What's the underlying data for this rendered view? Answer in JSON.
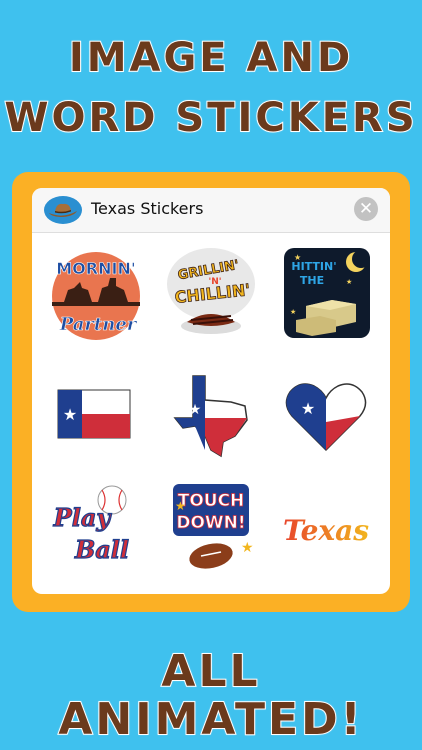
{
  "headline": {
    "line1": "IMAGE AND",
    "line2": "WORD STICKERS",
    "line3": "ALL ANIMATED!"
  },
  "panel": {
    "title": "Texas Stickers",
    "close_symbol": "✕"
  },
  "stickers": [
    {
      "name": "mornin-partner",
      "lines": [
        "MORNIN'",
        "Partner"
      ]
    },
    {
      "name": "grillin-n-chillin",
      "lines": [
        "GRILLIN'",
        "'N'",
        "CHILLIN'"
      ]
    },
    {
      "name": "hittin-the-hay",
      "lines": [
        "HITTIN'",
        "THE"
      ]
    },
    {
      "name": "texas-flag",
      "lines": []
    },
    {
      "name": "texas-map-flag",
      "lines": []
    },
    {
      "name": "texas-heart",
      "lines": []
    },
    {
      "name": "play-ball",
      "lines": [
        "Play",
        "Ball"
      ]
    },
    {
      "name": "touch-down",
      "lines": [
        "TOUCH",
        "DOWN!"
      ]
    },
    {
      "name": "texas-script",
      "lines": [
        "Texas"
      ]
    }
  ],
  "colors": {
    "background": "#3fc1ee",
    "frame": "#fbb025",
    "headline": "#6b3a1c",
    "flag_blue": "#1f3f8f",
    "flag_red": "#cf2e3a"
  }
}
